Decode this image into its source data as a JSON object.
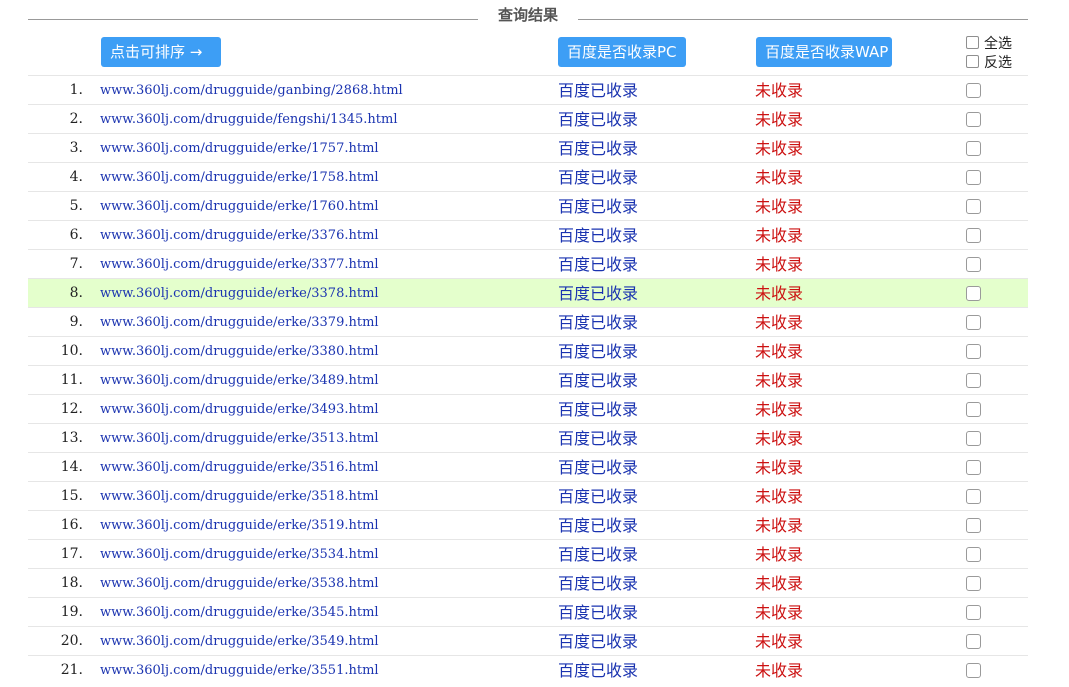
{
  "legend": "查询结果",
  "header": {
    "sort_button": "点击可排序 →",
    "pc_button": "百度是否收录PC",
    "wap_button": "百度是否收录WAP",
    "select_all": "全选",
    "invert_select": "反选"
  },
  "colors": {
    "button_bg": "#3d9ef5",
    "link": "#1a33b0",
    "status_not_indexed": "#cc1111",
    "highlight_row": "#e4ffcc"
  },
  "rows": [
    {
      "num": "1.",
      "url": "www.360lj.com/drugguide/ganbing/2868.html",
      "pc": "百度已收录",
      "wap": "未收录"
    },
    {
      "num": "2.",
      "url": "www.360lj.com/drugguide/fengshi/1345.html",
      "pc": "百度已收录",
      "wap": "未收录"
    },
    {
      "num": "3.",
      "url": "www.360lj.com/drugguide/erke/1757.html",
      "pc": "百度已收录",
      "wap": "未收录"
    },
    {
      "num": "4.",
      "url": "www.360lj.com/drugguide/erke/1758.html",
      "pc": "百度已收录",
      "wap": "未收录"
    },
    {
      "num": "5.",
      "url": "www.360lj.com/drugguide/erke/1760.html",
      "pc": "百度已收录",
      "wap": "未收录"
    },
    {
      "num": "6.",
      "url": "www.360lj.com/drugguide/erke/3376.html",
      "pc": "百度已收录",
      "wap": "未收录"
    },
    {
      "num": "7.",
      "url": "www.360lj.com/drugguide/erke/3377.html",
      "pc": "百度已收录",
      "wap": "未收录"
    },
    {
      "num": "8.",
      "url": "www.360lj.com/drugguide/erke/3378.html",
      "pc": "百度已收录",
      "wap": "未收录"
    },
    {
      "num": "9.",
      "url": "www.360lj.com/drugguide/erke/3379.html",
      "pc": "百度已收录",
      "wap": "未收录"
    },
    {
      "num": "10.",
      "url": "www.360lj.com/drugguide/erke/3380.html",
      "pc": "百度已收录",
      "wap": "未收录"
    },
    {
      "num": "11.",
      "url": "www.360lj.com/drugguide/erke/3489.html",
      "pc": "百度已收录",
      "wap": "未收录"
    },
    {
      "num": "12.",
      "url": "www.360lj.com/drugguide/erke/3493.html",
      "pc": "百度已收录",
      "wap": "未收录"
    },
    {
      "num": "13.",
      "url": "www.360lj.com/drugguide/erke/3513.html",
      "pc": "百度已收录",
      "wap": "未收录"
    },
    {
      "num": "14.",
      "url": "www.360lj.com/drugguide/erke/3516.html",
      "pc": "百度已收录",
      "wap": "未收录"
    },
    {
      "num": "15.",
      "url": "www.360lj.com/drugguide/erke/3518.html",
      "pc": "百度已收录",
      "wap": "未收录"
    },
    {
      "num": "16.",
      "url": "www.360lj.com/drugguide/erke/3519.html",
      "pc": "百度已收录",
      "wap": "未收录"
    },
    {
      "num": "17.",
      "url": "www.360lj.com/drugguide/erke/3534.html",
      "pc": "百度已收录",
      "wap": "未收录"
    },
    {
      "num": "18.",
      "url": "www.360lj.com/drugguide/erke/3538.html",
      "pc": "百度已收录",
      "wap": "未收录"
    },
    {
      "num": "19.",
      "url": "www.360lj.com/drugguide/erke/3545.html",
      "pc": "百度已收录",
      "wap": "未收录"
    },
    {
      "num": "20.",
      "url": "www.360lj.com/drugguide/erke/3549.html",
      "pc": "百度已收录",
      "wap": "未收录"
    },
    {
      "num": "21.",
      "url": "www.360lj.com/drugguide/erke/3551.html",
      "pc": "百度已收录",
      "wap": "未收录"
    }
  ]
}
